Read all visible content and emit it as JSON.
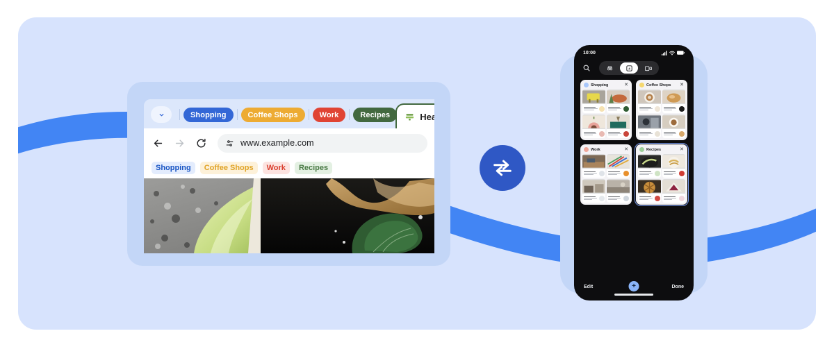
{
  "theme": {
    "page_bg": "#ffffff",
    "hero_bg": "#d7e3fd",
    "wave_blue": "#4285f4",
    "device_frame": "#c3d6f7",
    "sync_badge": "#2f58c5",
    "phone_bg": "#0d0d0f",
    "accent_blue": "#8ab4f8"
  },
  "browser": {
    "collapse_icon": "chevron-down-icon",
    "tab_groups": [
      {
        "label": "Shopping",
        "color": "#3367d6",
        "class": "shopping"
      },
      {
        "label": "Coffee Shops",
        "color": "#edab33",
        "class": "coffee"
      },
      {
        "label": "Work",
        "color": "#e04434",
        "class": "work"
      },
      {
        "label": "Recipes",
        "color": "#43693f",
        "class": "recipes"
      }
    ],
    "active_tab": {
      "title": "Hearty Herb",
      "favicon": "tab-group-icon",
      "group_color": "#43693f"
    },
    "toolbar": {
      "back_icon": "back-arrow-icon",
      "forward_icon": "forward-arrow-icon",
      "reload_icon": "reload-icon",
      "site_settings_icon": "tune-icon",
      "url": "www.example.com"
    },
    "bookmarks": [
      {
        "label": "Shopping",
        "class": "shopping"
      },
      {
        "label": "Coffee Shops",
        "class": "coffee"
      },
      {
        "label": "Work",
        "class": "work"
      },
      {
        "label": "Recipes",
        "class": "recipes"
      }
    ]
  },
  "sync": {
    "icon": "sync-arrows-icon"
  },
  "phone": {
    "status": {
      "time": "10:00",
      "signal_icon": "cellular-signal-icon",
      "wifi_icon": "wifi-icon",
      "battery_icon": "battery-icon"
    },
    "toolbar": {
      "search_icon": "search-icon",
      "segments": [
        {
          "icon": "incognito-icon",
          "active": false
        },
        {
          "icon": "tab-count-icon",
          "active": true,
          "count": "4"
        },
        {
          "icon": "tab-groups-icon",
          "active": false
        }
      ]
    },
    "tab_groups": [
      {
        "name": "Shopping",
        "dot": "#a8c7fa",
        "close_icon": "close-icon",
        "selected": false
      },
      {
        "name": "Coffee Shops",
        "dot": "#f5d76e",
        "close_icon": "close-icon",
        "selected": false
      },
      {
        "name": "Work",
        "dot": "#f0a89a",
        "close_icon": "close-icon",
        "selected": false
      },
      {
        "name": "Recipes",
        "dot": "#9dcf9a",
        "close_icon": "close-icon",
        "selected": true
      }
    ],
    "bottom": {
      "edit_label": "Edit",
      "new_tab_icon": "plus-icon",
      "done_label": "Done"
    }
  }
}
